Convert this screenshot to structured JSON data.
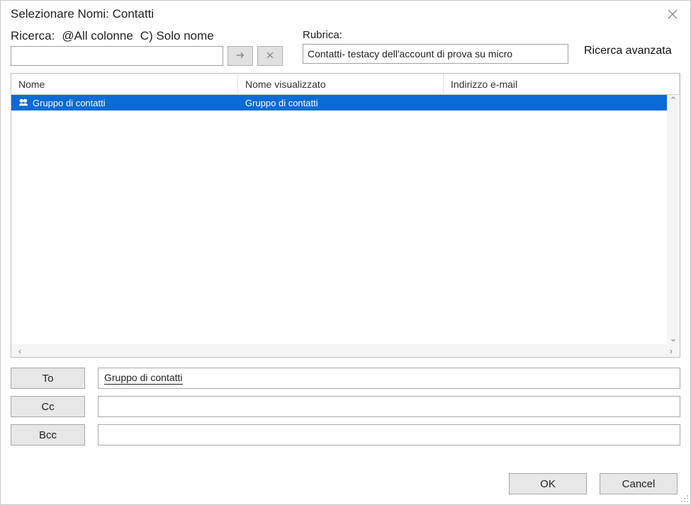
{
  "title": "Selezionare Nomi: Contatti",
  "search": {
    "label": "Ricerca:",
    "option_all": "@All colonne",
    "option_name_only": "C) Solo nome",
    "input_value": "",
    "go_icon": "arrow-right-icon",
    "clear_icon": "x-icon"
  },
  "rubrica": {
    "label": "Rubrica:",
    "value": "Contatti- testacy dell'account di prova su micro"
  },
  "advanced_search": "Ricerca avanzata",
  "columns": {
    "name": "Nome",
    "display": "Nome visualizzato",
    "email": "Indirizzo e-mail"
  },
  "rows": [
    {
      "name": "Gruppo di contatti",
      "display": "Gruppo di contatti",
      "email": ""
    }
  ],
  "recipients": {
    "to_label": "To",
    "to_value": "Gruppo di contatti",
    "cc_label": "Cc",
    "cc_value": "",
    "bcc_label": "Bcc",
    "bcc_value": ""
  },
  "buttons": {
    "ok": "OK",
    "cancel": "Cancel"
  }
}
